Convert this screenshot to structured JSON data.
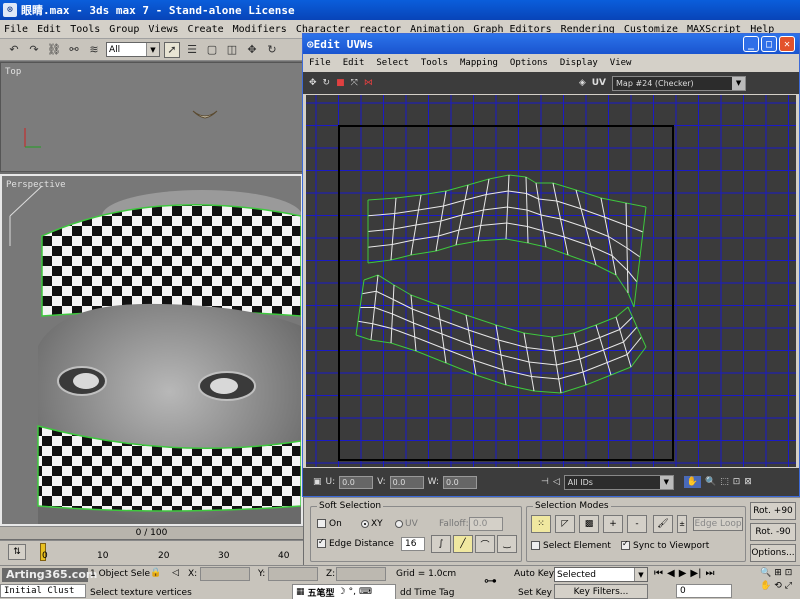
{
  "app": {
    "title": "眼睛.max - 3ds max 7 - Stand-alone License",
    "menu": [
      "File",
      "Edit",
      "Tools",
      "Group",
      "Views",
      "Create",
      "Modifiers",
      "Character",
      "reactor",
      "Animation",
      "Graph Editors",
      "Rendering",
      "Customize",
      "MAXScript",
      "Help"
    ]
  },
  "toolbar": {
    "selection_filter": "All"
  },
  "viewports": {
    "top_label": "Top",
    "persp_label": "Perspective"
  },
  "uvw": {
    "title": "Edit UVWs",
    "menu": [
      "File",
      "Edit",
      "Select",
      "Tools",
      "Mapping",
      "Options",
      "Display",
      "View"
    ],
    "uv_label": "UV",
    "map_combo": "Map #24 (Checker)",
    "u_label": "U:",
    "u_value": "0.0",
    "v_label": "V:",
    "v_value": "0.0",
    "w_label": "W:",
    "w_value": "0.0",
    "ids_combo": "All IDs"
  },
  "soft_selection": {
    "title": "Soft Selection",
    "on_label": "On",
    "xy_label": "XY",
    "uv_label": "UV",
    "falloff_label": "Falloff:",
    "falloff_value": "0.0",
    "edge_distance_label": "Edge Distance",
    "edge_distance_value": "16"
  },
  "selection_modes": {
    "title": "Selection Modes",
    "plus": "+",
    "minus": "-",
    "edge_loop": "Edge Loop",
    "select_element": "Select Element",
    "sync_viewport": "Sync to Viewport"
  },
  "rotate": {
    "plus90": "Rot. +90",
    "minus90": "Rot. -90",
    "options": "Options..."
  },
  "timeline": {
    "frame": "0 / 100",
    "ticks": [
      "0",
      "10",
      "20",
      "30",
      "40"
    ]
  },
  "status": {
    "clust": "Initial Clust",
    "object_sel": "1 Object Sele",
    "x_label": "X:",
    "y_label": "Y:",
    "z_label": "Z:",
    "grid": "Grid = 1.0cm",
    "auto_key": "Auto Key",
    "selected": "Selected",
    "set_key": "Set Key",
    "key_filters": "Key Filters...",
    "frame_value": "0",
    "prompt": "Select texture vertices",
    "add_time_tag": "dd Time Tag",
    "ime": "五笔型",
    "watermark": "Arting365.com"
  },
  "colors": {
    "accent": "#1a54cf",
    "grid_line": "#1a1ac8",
    "uv_edge": "#e8e8e8",
    "uv_border": "#3ec83e"
  }
}
